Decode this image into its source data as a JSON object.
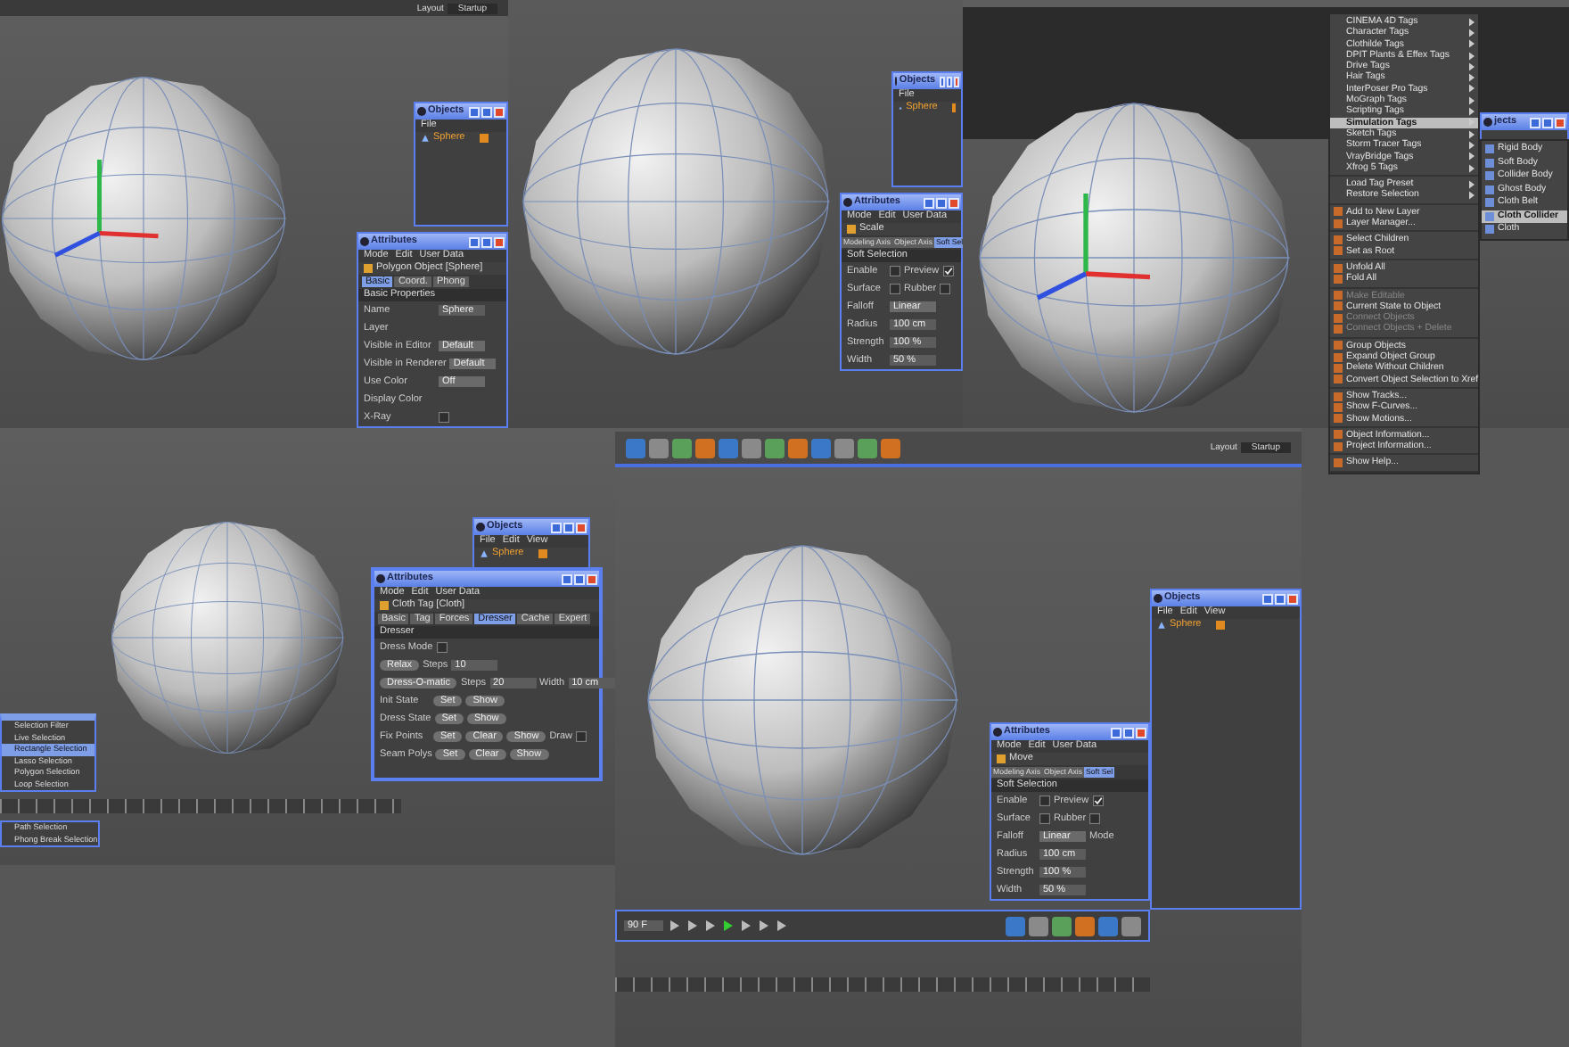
{
  "tiles": [
    {
      "top_bar": {
        "kind": "plain",
        "label": "Layout",
        "value": "Startup"
      },
      "objects": {
        "title": "Objects",
        "menus": [
          "File"
        ],
        "object": "Sphere"
      },
      "attributes": {
        "title": "Attributes",
        "menus": [
          "Mode",
          "Edit",
          "User Data"
        ],
        "subtitle": "Polygon Object [Sphere]",
        "tabs": [
          {
            "label": "Basic",
            "selected": true
          },
          {
            "label": "Coord.",
            "selected": false
          },
          {
            "label": "Phong",
            "selected": false
          }
        ],
        "section": "Basic Properties",
        "rows": [
          {
            "label": "Name",
            "cells": [
              {
                "kind": "field",
                "text": "Sphere"
              }
            ]
          },
          {
            "label": "Layer",
            "cells": [
              {
                "kind": "field"
              }
            ]
          },
          {
            "label": "Visible in Editor",
            "cells": [
              {
                "kind": "select",
                "text": "Default"
              }
            ]
          },
          {
            "label": "Visible in Renderer",
            "cells": [
              {
                "kind": "select",
                "text": "Default"
              }
            ]
          },
          {
            "label": "Use Color",
            "cells": [
              {
                "kind": "select",
                "text": "Off"
              }
            ]
          },
          {
            "label": "Display Color",
            "cells": [
              {
                "kind": "field"
              }
            ]
          },
          {
            "label": "X-Ray",
            "cells": [
              {
                "kind": "check",
                "checked": false
              }
            ]
          }
        ]
      }
    },
    {
      "objects": {
        "title": "Objects",
        "menus": [
          "File"
        ],
        "object": "Sphere"
      },
      "attributes": {
        "title": "Attributes",
        "menus": [
          "Mode",
          "Edit",
          "User Data"
        ],
        "subtitle": "Scale",
        "tabs": [
          {
            "label": "Modeling Axis",
            "selected": false
          },
          {
            "label": "Object Axis",
            "selected": false
          },
          {
            "label": "Soft Sel",
            "selected": true
          }
        ],
        "section": "Soft Selection",
        "rows": [
          {
            "label": "Enable",
            "cells": [
              {
                "kind": "check",
                "checked": false
              },
              {
                "kind": "check",
                "label": "Preview",
                "checked": true
              }
            ]
          },
          {
            "label": "Surface",
            "cells": [
              {
                "kind": "check",
                "checked": false
              },
              {
                "kind": "check",
                "label": "Rubber",
                "checked": false
              }
            ]
          },
          {
            "label": "Falloff",
            "cells": [
              {
                "kind": "select",
                "text": "Linear"
              }
            ]
          },
          {
            "label": "Radius",
            "cells": [
              {
                "kind": "field",
                "text": "100 cm"
              }
            ]
          },
          {
            "label": "Strength",
            "cells": [
              {
                "kind": "field",
                "text": "100 %"
              }
            ]
          },
          {
            "label": "Width",
            "cells": [
              {
                "kind": "field",
                "text": "50 %"
              }
            ]
          }
        ]
      }
    },
    {
      "top_bar": {
        "kind": "dark"
      },
      "objects": {
        "title": "jects"
      }
    },
    {
      "objects": {
        "title": "Objects",
        "menus": [
          "File",
          "Edit",
          "View"
        ],
        "object": "Sphere"
      },
      "attributes": {
        "title": "Attributes",
        "menus": [
          "Mode",
          "Edit",
          "User Data"
        ],
        "subtitle": "Cloth Tag [Cloth]",
        "tabs": [
          {
            "label": "Basic",
            "selected": false
          },
          {
            "label": "Tag",
            "selected": false
          },
          {
            "label": "Forces",
            "selected": false
          },
          {
            "label": "Dresser",
            "selected": true
          },
          {
            "label": "Cache",
            "selected": false
          },
          {
            "label": "Expert",
            "selected": false
          }
        ],
        "section": "Dresser",
        "rows": [
          {
            "label": "Dress Mode",
            "cells": [
              {
                "kind": "check",
                "checked": false
              }
            ]
          },
          {
            "cells": [
              {
                "kind": "button",
                "text": "Relax"
              },
              {
                "kind": "label",
                "text": "Steps"
              },
              {
                "kind": "field",
                "text": "10"
              }
            ]
          },
          {
            "cells": [
              {
                "kind": "button",
                "text": "Dress-O-matic"
              },
              {
                "kind": "label",
                "text": "Steps"
              },
              {
                "kind": "field",
                "text": "20"
              },
              {
                "kind": "label",
                "text": "Width"
              },
              {
                "kind": "field",
                "text": "10 cm"
              }
            ]
          },
          {
            "label": "Init State",
            "cells": [
              {
                "kind": "button",
                "text": "Set"
              },
              {
                "kind": "button",
                "text": "Show"
              }
            ]
          },
          {
            "label": "Dress State",
            "cells": [
              {
                "kind": "button",
                "text": "Set"
              },
              {
                "kind": "button",
                "text": "Show"
              }
            ]
          },
          {
            "label": "Fix Points",
            "cells": [
              {
                "kind": "button",
                "text": "Set"
              },
              {
                "kind": "button",
                "text": "Clear"
              },
              {
                "kind": "button",
                "text": "Show"
              },
              {
                "kind": "check",
                "label": "Draw",
                "checked": false
              }
            ]
          },
          {
            "label": "Seam Polys",
            "cells": [
              {
                "kind": "button",
                "text": "Set"
              },
              {
                "kind": "button",
                "text": "Clear"
              },
              {
                "kind": "button",
                "text": "Show"
              }
            ]
          }
        ]
      },
      "selection_menu": {
        "items": [
          {
            "label": "Selection Filter",
            "selected": false
          },
          {
            "label": "Live Selection",
            "selected": false
          },
          {
            "label": "Rectangle Selection",
            "selected": true
          },
          {
            "label": "Lasso Selection",
            "selected": false
          },
          {
            "label": "Polygon Selection",
            "selected": false
          },
          {
            "label": "Loop Selection",
            "selected": false
          }
        ]
      },
      "path_menu": {
        "items": [
          {
            "label": "Path Selection",
            "selected": false
          },
          {
            "label": "Phong Break Selection",
            "selected": false
          }
        ]
      }
    },
    {
      "top_bar": {
        "kind": "icons",
        "label": "Layout",
        "value": "Startup"
      },
      "objects": {
        "title": "Objects",
        "menus": [
          "File",
          "Edit",
          "View"
        ],
        "object": "Sphere"
      },
      "attributes": {
        "title": "Attributes",
        "menus": [
          "Mode",
          "Edit",
          "User Data"
        ],
        "subtitle": "Move",
        "tabs": [
          {
            "label": "Modeling Axis",
            "selected": false
          },
          {
            "label": "Object Axis",
            "selected": false
          },
          {
            "label": "Soft Sel",
            "selected": true
          }
        ],
        "section": "Soft Selection",
        "rows": [
          {
            "label": "Enable",
            "cells": [
              {
                "kind": "check",
                "checked": false
              },
              {
                "kind": "check",
                "label": "Preview",
                "checked": true
              }
            ]
          },
          {
            "label": "Surface",
            "cells": [
              {
                "kind": "check",
                "checked": false
              },
              {
                "kind": "check",
                "label": "Rubber",
                "checked": false
              }
            ]
          },
          {
            "label": "Falloff",
            "cells": [
              {
                "kind": "select",
                "text": "Linear"
              },
              {
                "kind": "label",
                "text": "Mode"
              }
            ]
          },
          {
            "label": "Radius",
            "cells": [
              {
                "kind": "field",
                "text": "100 cm"
              }
            ]
          },
          {
            "label": "Strength",
            "cells": [
              {
                "kind": "field",
                "text": "100 %"
              }
            ]
          },
          {
            "label": "Width",
            "cells": [
              {
                "kind": "field",
                "text": "50 %"
              }
            ]
          }
        ]
      },
      "timeline": {
        "frame": "90 F"
      }
    }
  ],
  "context_menu": {
    "groups": [
      {
        "items": [
          {
            "label": "CINEMA 4D Tags",
            "kind": "submenu",
            "selected": false,
            "disabled": false
          },
          {
            "label": "Character Tags",
            "kind": "submenu",
            "selected": false,
            "disabled": false
          },
          {
            "label": "Clothilde Tags",
            "kind": "submenu",
            "selected": false,
            "disabled": false
          },
          {
            "label": "DPIT Plants & Effex Tags",
            "kind": "submenu",
            "selected": false,
            "disabled": false
          },
          {
            "label": "Drive Tags",
            "kind": "submenu",
            "selected": false,
            "disabled": false
          },
          {
            "label": "Hair Tags",
            "kind": "submenu",
            "selected": false,
            "disabled": false
          },
          {
            "label": "InterPoser Pro Tags",
            "kind": "submenu",
            "selected": false,
            "disabled": false
          },
          {
            "label": "MoGraph Tags",
            "kind": "submenu",
            "selected": false,
            "disabled": false
          },
          {
            "label": "Scripting Tags",
            "kind": "submenu",
            "selected": false,
            "disabled": false
          },
          {
            "label": "Simulation Tags",
            "kind": "submenu",
            "selected": true,
            "disabled": false
          },
          {
            "label": "Sketch Tags",
            "kind": "submenu",
            "selected": false,
            "disabled": false
          },
          {
            "label": "Storm Tracer Tags",
            "kind": "submenu",
            "selected": false,
            "disabled": false
          },
          {
            "label": "VrayBridge Tags",
            "kind": "submenu",
            "selected": false,
            "disabled": false
          },
          {
            "label": "Xfrog 5 Tags",
            "kind": "submenu",
            "selected": false,
            "disabled": false
          }
        ]
      },
      {
        "items": [
          {
            "label": "Load Tag Preset",
            "kind": "submenu",
            "selected": false,
            "disabled": false
          },
          {
            "label": "Restore Selection",
            "kind": "submenu",
            "selected": false,
            "disabled": false
          }
        ]
      },
      {
        "items": [
          {
            "label": "Add to New Layer",
            "kind": "action",
            "selected": false,
            "disabled": false
          },
          {
            "label": "Layer Manager...",
            "kind": "action",
            "selected": false,
            "disabled": false
          }
        ]
      },
      {
        "items": [
          {
            "label": "Select Children",
            "kind": "action",
            "selected": false,
            "disabled": false
          },
          {
            "label": "Set as Root",
            "kind": "action",
            "selected": false,
            "disabled": false
          }
        ]
      },
      {
        "items": [
          {
            "label": "Unfold All",
            "kind": "action",
            "selected": false,
            "disabled": false
          },
          {
            "label": "Fold All",
            "kind": "action",
            "selected": false,
            "disabled": false
          }
        ]
      },
      {
        "items": [
          {
            "label": "Make Editable",
            "kind": "action",
            "selected": false,
            "disabled": true
          },
          {
            "label": "Current State to Object",
            "kind": "action",
            "selected": false,
            "disabled": false
          },
          {
            "label": "Connect Objects",
            "kind": "action",
            "selected": false,
            "disabled": true
          },
          {
            "label": "Connect Objects + Delete",
            "kind": "action",
            "selected": false,
            "disabled": true
          }
        ]
      },
      {
        "items": [
          {
            "label": "Group Objects",
            "kind": "action",
            "selected": false,
            "disabled": false
          },
          {
            "label": "Expand Object Group",
            "kind": "action",
            "selected": false,
            "disabled": false
          },
          {
            "label": "Delete Without Children",
            "kind": "action",
            "selected": false,
            "disabled": false
          },
          {
            "label": "Convert Object Selection to Xref",
            "kind": "action",
            "selected": false,
            "disabled": false
          }
        ]
      },
      {
        "items": [
          {
            "label": "Show Tracks...",
            "kind": "action",
            "selected": false,
            "disabled": false
          },
          {
            "label": "Show F-Curves...",
            "kind": "action",
            "selected": false,
            "disabled": false
          },
          {
            "label": "Show Motions...",
            "kind": "action",
            "selected": false,
            "disabled": false
          }
        ]
      },
      {
        "items": [
          {
            "label": "Object Information...",
            "kind": "action",
            "selected": false,
            "disabled": false
          },
          {
            "label": "Project Information...",
            "kind": "action",
            "selected": false,
            "disabled": false
          }
        ]
      },
      {
        "items": [
          {
            "label": "Show Help...",
            "kind": "action",
            "selected": false,
            "disabled": false
          }
        ]
      }
    ],
    "submenu": {
      "items": [
        {
          "label": "Rigid Body",
          "selected": false
        },
        {
          "label": "Soft Body",
          "selected": false
        },
        {
          "label": "Collider Body",
          "selected": false
        },
        {
          "label": "Ghost Body",
          "selected": false
        },
        {
          "label": "Cloth Belt",
          "selected": false
        },
        {
          "label": "Cloth Collider",
          "selected": true
        },
        {
          "label": "Cloth",
          "selected": false
        }
      ]
    }
  }
}
